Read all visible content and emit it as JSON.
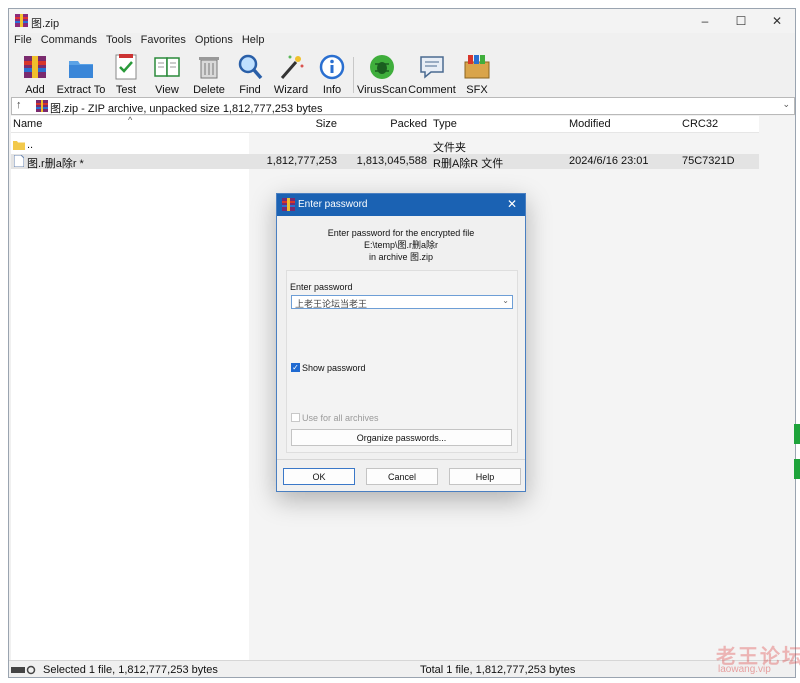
{
  "window": {
    "title": "图.zip",
    "controls": {
      "minimize": "–",
      "maximize": "☐",
      "close": "✕"
    }
  },
  "menu": [
    "File",
    "Commands",
    "Tools",
    "Favorites",
    "Options",
    "Help"
  ],
  "toolbar": [
    {
      "label": "Add",
      "icon": "add-archive-icon"
    },
    {
      "label": "Extract To",
      "icon": "extract-folder-icon"
    },
    {
      "label": "Test",
      "icon": "test-clipboard-icon"
    },
    {
      "label": "View",
      "icon": "view-book-icon"
    },
    {
      "label": "Delete",
      "icon": "delete-bin-icon"
    },
    {
      "label": "Find",
      "icon": "find-magnifier-icon"
    },
    {
      "label": "Wizard",
      "icon": "wizard-wand-icon"
    },
    {
      "label": "Info",
      "icon": "info-icon"
    },
    {
      "label": "VirusScan",
      "icon": "virusscan-bug-icon"
    },
    {
      "label": "Comment",
      "icon": "comment-icon"
    },
    {
      "label": "SFX",
      "icon": "sfx-box-icon"
    }
  ],
  "address": {
    "up": "↑",
    "path": "图.zip - ZIP archive, unpacked size 1,812,777,253 bytes",
    "dropdown": "⌄"
  },
  "columns": {
    "name": "Name",
    "size": "Size",
    "packed": "Packed",
    "type": "Type",
    "modified": "Modified",
    "crc": "CRC32",
    "sort_arrow": "^"
  },
  "files": [
    {
      "name": "..",
      "size": "",
      "packed": "",
      "type": "文件夹",
      "modified": "",
      "crc": ""
    },
    {
      "name": "图.r删a除r *",
      "size": "1,812,777,253",
      "packed": "1,813,045,588",
      "type": "R删A除R 文件",
      "modified": "2024/6/16 23:01",
      "crc": "75C7321D"
    }
  ],
  "status": {
    "left": "Selected 1 file, 1,812,777,253 bytes",
    "right": "Total 1 file, 1,812,777,253 bytes"
  },
  "watermark": {
    "big": "老王论坛",
    "small": "laowang.vip"
  },
  "dialog": {
    "title": "Enter password",
    "close": "✕",
    "info_line1": "Enter password for the encrypted file",
    "info_line2": "E:\\temp\\图.r删a除r",
    "info_line3": "in archive 图.zip",
    "password_label": "Enter password",
    "password_value": "上老王论坛当老王",
    "dropdown": "⌄",
    "show_password": "Show password",
    "show_password_checked": true,
    "use_all_archives": "Use for all archives",
    "organize": "Organize passwords...",
    "ok": "OK",
    "cancel": "Cancel",
    "help": "Help"
  },
  "colors": {
    "title_bar": "#1b62b3",
    "accent_green": "#1ea33a",
    "checkbox": "#1f6ad1"
  }
}
